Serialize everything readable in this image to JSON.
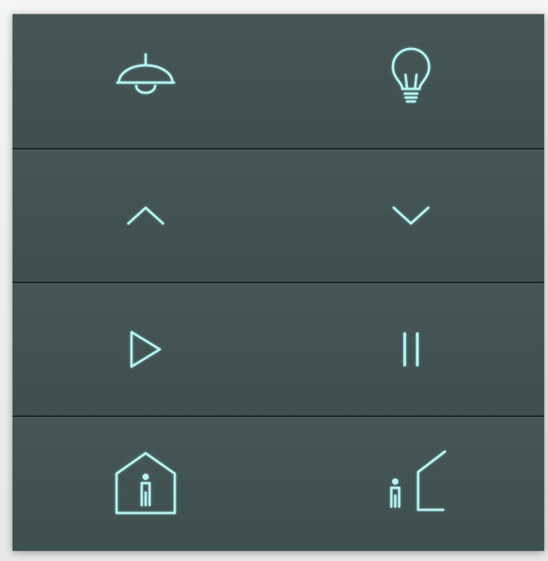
{
  "panel": {
    "background_color": "#3f5050",
    "icon_color": "#b9f3f2",
    "rows": [
      {
        "left_icon": "ceiling-lamp-icon",
        "right_icon": "light-bulb-icon"
      },
      {
        "left_icon": "chevron-up-icon",
        "right_icon": "chevron-down-icon"
      },
      {
        "left_icon": "play-icon",
        "right_icon": "pause-icon"
      },
      {
        "left_icon": "person-at-home-icon",
        "right_icon": "person-leaving-home-icon"
      }
    ]
  }
}
